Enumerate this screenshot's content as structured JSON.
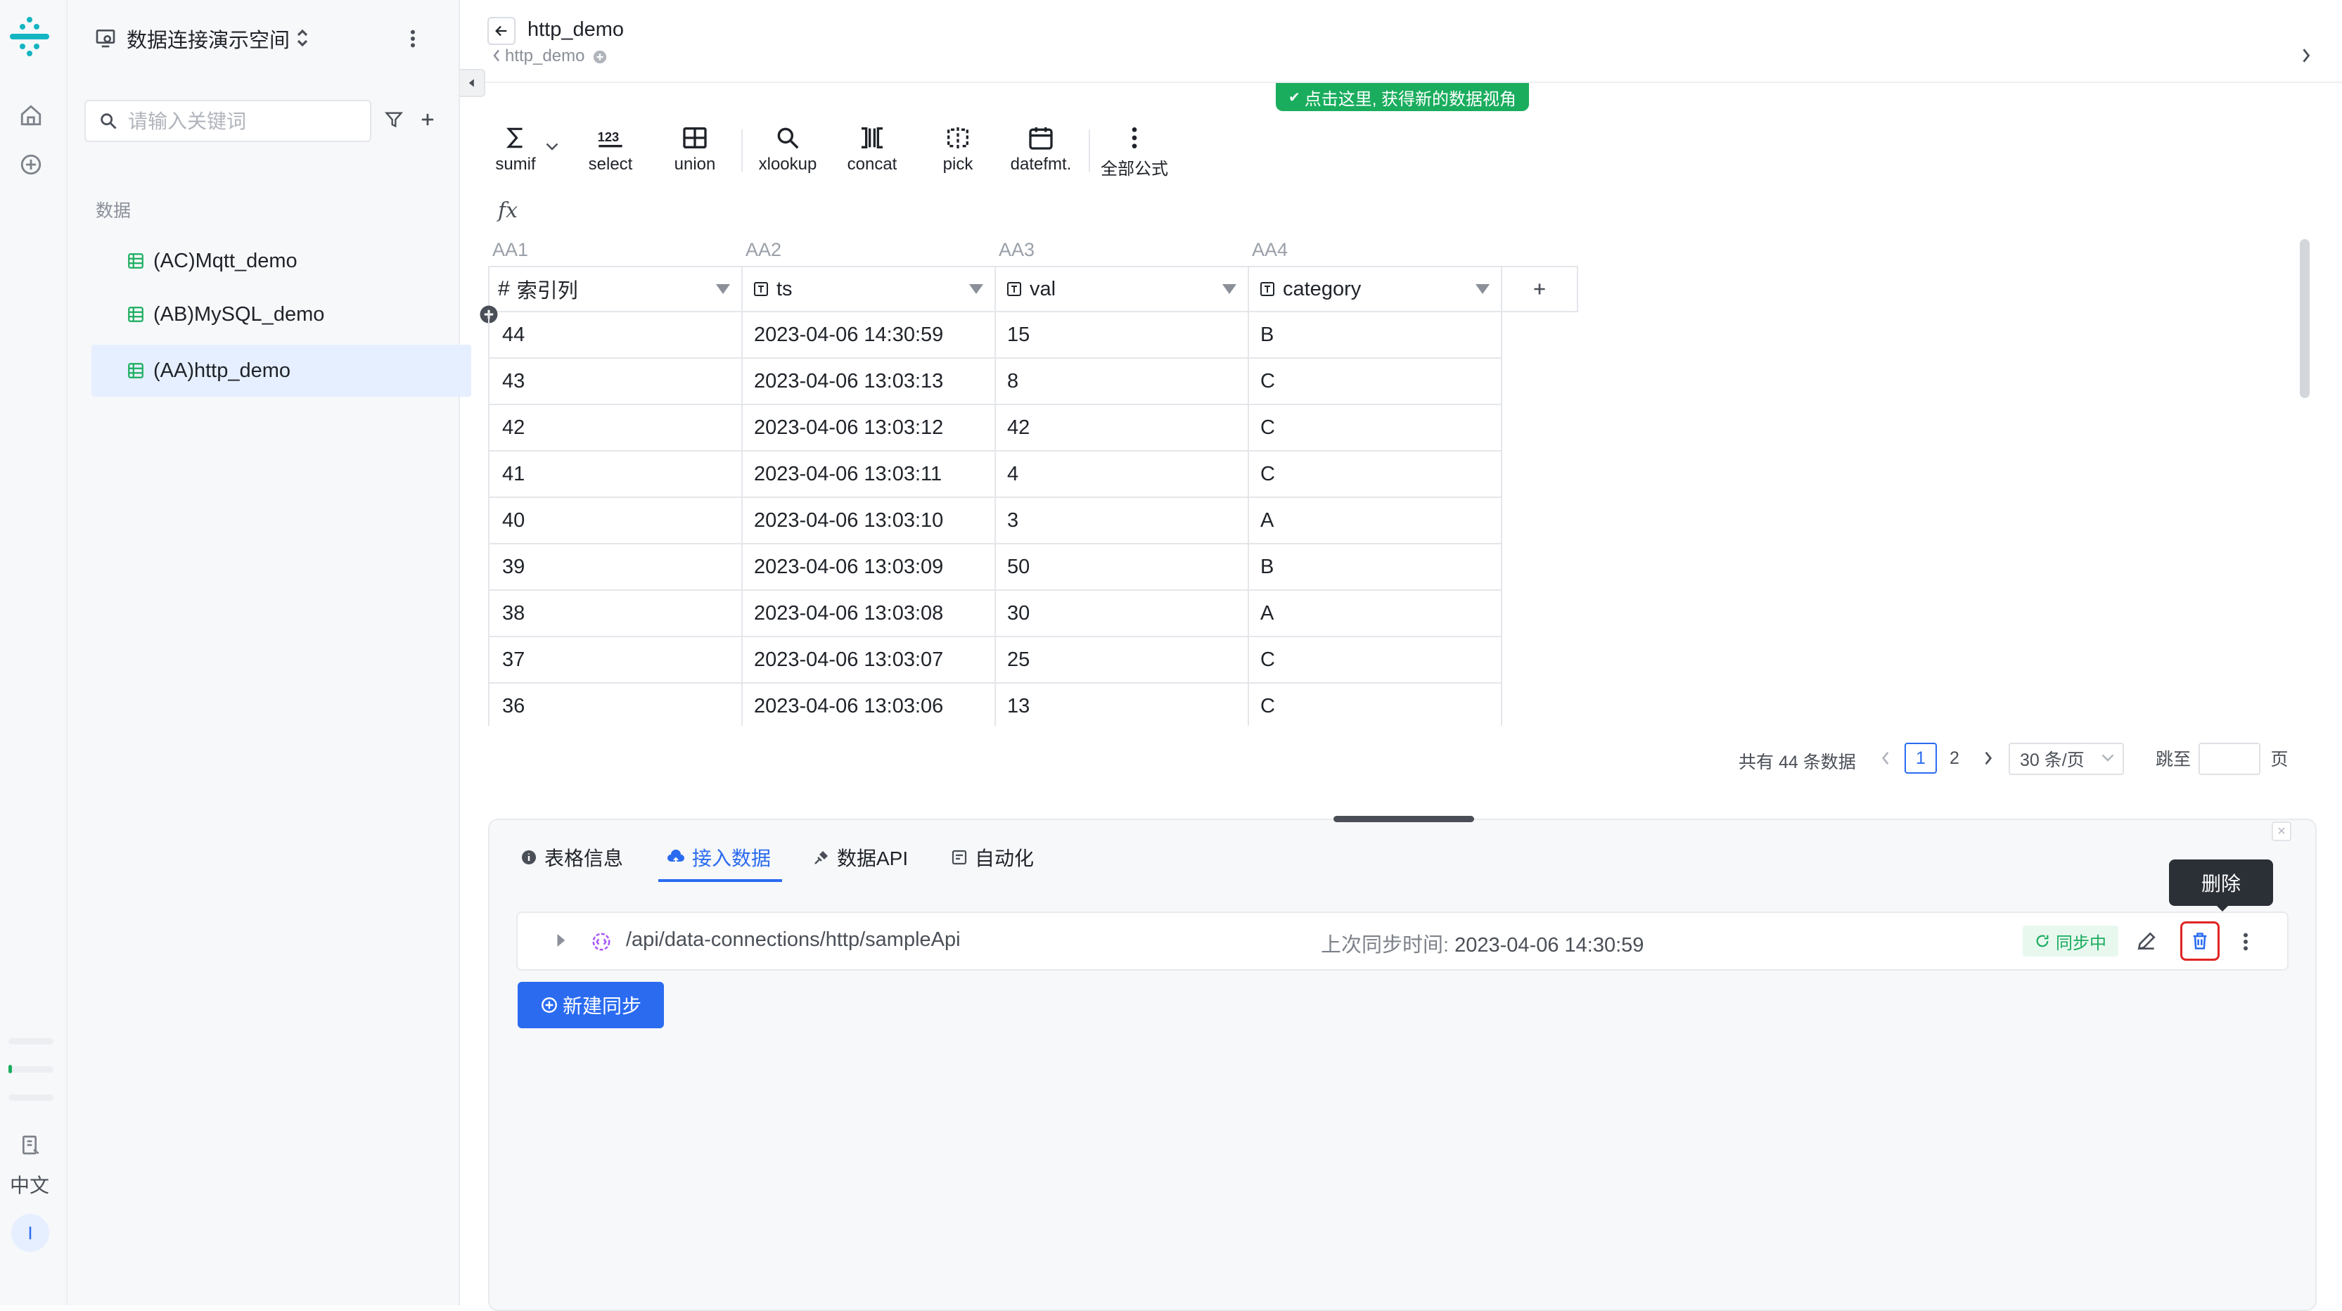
{
  "rail": {
    "lang_label": "中文",
    "avatar_letter": "I"
  },
  "sidebar": {
    "workspace_name": "数据连接演示空间",
    "search_placeholder": "请输入关键词",
    "section_label": "数据",
    "items": [
      {
        "label": "(AC)Mqtt_demo"
      },
      {
        "label": "(AB)MySQL_demo"
      },
      {
        "label": "(AA)http_demo"
      }
    ]
  },
  "header": {
    "title": "http_demo",
    "subtitle": "http_demo",
    "banner": "点击这里, 获得新的数据视角"
  },
  "toolbar": {
    "tools": [
      {
        "label": "sumif",
        "icon": "sigma-icon"
      },
      {
        "label": "select",
        "icon": "numbers-icon"
      },
      {
        "label": "union",
        "icon": "union-icon"
      },
      {
        "label": "xlookup",
        "icon": "search-icon"
      },
      {
        "label": "concat",
        "icon": "concat-icon"
      },
      {
        "label": "pick",
        "icon": "pick-icon"
      },
      {
        "label": "datefmt.",
        "icon": "calendar-icon"
      },
      {
        "label": "全部公式",
        "icon": "more-vertical-icon"
      }
    ],
    "fx_label": "fx"
  },
  "grid": {
    "column_ids": [
      "AA1",
      "AA2",
      "AA3",
      "AA4"
    ],
    "headers": [
      "索引列",
      "ts",
      "val",
      "category"
    ],
    "rows": [
      [
        "44",
        "2023-04-06 14:30:59",
        "15",
        "B"
      ],
      [
        "43",
        "2023-04-06 13:03:13",
        "8",
        "C"
      ],
      [
        "42",
        "2023-04-06 13:03:12",
        "42",
        "C"
      ],
      [
        "41",
        "2023-04-06 13:03:11",
        "4",
        "C"
      ],
      [
        "40",
        "2023-04-06 13:03:10",
        "3",
        "A"
      ],
      [
        "39",
        "2023-04-06 13:03:09",
        "50",
        "B"
      ],
      [
        "38",
        "2023-04-06 13:03:08",
        "30",
        "A"
      ],
      [
        "37",
        "2023-04-06 13:03:07",
        "25",
        "C"
      ],
      [
        "36",
        "2023-04-06 13:03:06",
        "13",
        "C"
      ]
    ]
  },
  "pagination": {
    "total_text": "共有 44 条数据",
    "pages": [
      "1",
      "2"
    ],
    "page_size": "30 条/页",
    "goto_label": "跳至",
    "page_unit": "页"
  },
  "panel": {
    "tabs": [
      {
        "label": "表格信息"
      },
      {
        "label": "接入数据"
      },
      {
        "label": "数据API"
      },
      {
        "label": "自动化"
      }
    ],
    "sync": {
      "path": "/api/data-connections/http/sampleApi",
      "last_sync_label": "上次同步时间: ",
      "last_sync_value": "2023-04-06 14:30:59",
      "status": "同步中"
    },
    "tooltip": "删除",
    "new_sync_label": "新建同步"
  },
  "colors": {
    "accent": "#2a6bf0",
    "success": "#1aad5e",
    "danger": "#e02424",
    "brand": "#13b5c1"
  }
}
